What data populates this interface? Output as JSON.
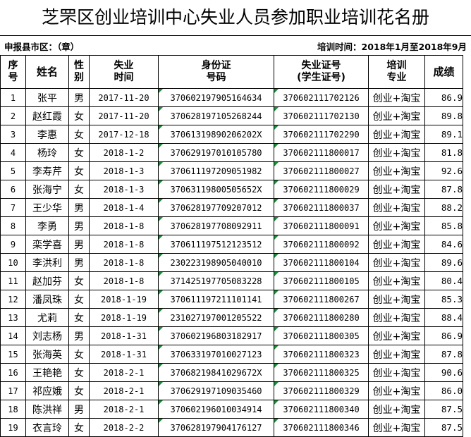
{
  "title": "芝罘区创业培训中心失业人员参加职业培训花名册",
  "subheader": {
    "left": "申报县市区：（章）",
    "right": "培训时间：2018年1月至2018年9月"
  },
  "columns": {
    "seq": [
      "序",
      "号"
    ],
    "name": "姓名",
    "gender": [
      "性",
      "别"
    ],
    "unemp_time": [
      "失业",
      "时间"
    ],
    "id_number": [
      "身份证",
      "号码"
    ],
    "unemp_cert": [
      "失业证号",
      "(学生证号)"
    ],
    "major": [
      "培训",
      "专业"
    ],
    "score": "成绩"
  },
  "rows": [
    {
      "seq": "1",
      "name": "张平",
      "gender": "男",
      "time": "2017-11-20",
      "id": "370602197905164634",
      "cert": "370602111702126",
      "major": "创业+淘宝",
      "score": "86.9"
    },
    {
      "seq": "2",
      "name": "赵红霞",
      "gender": "女",
      "time": "2017-11-20",
      "id": "370628197105268244",
      "cert": "370602111702130",
      "major": "创业+淘宝",
      "score": "89.8"
    },
    {
      "seq": "3",
      "name": "李惠",
      "gender": "女",
      "time": "2017-12-18",
      "id": "37061319890206202X",
      "cert": "370602111702290",
      "major": "创业+淘宝",
      "score": "89.1"
    },
    {
      "seq": "4",
      "name": "杨玲",
      "gender": "女",
      "time": "2018-1-2",
      "id": "370629197010105780",
      "cert": "370602111800017",
      "major": "创业+淘宝",
      "score": "81.8"
    },
    {
      "seq": "5",
      "name": "李寿芹",
      "gender": "女",
      "time": "2018-1-3",
      "id": "370611197209051982",
      "cert": "370602111800027",
      "major": "创业+淘宝",
      "score": "92.6"
    },
    {
      "seq": "6",
      "name": "张海宁",
      "gender": "女",
      "time": "2018-1-3",
      "id": "37063119800505652X",
      "cert": "370602111800029",
      "major": "创业+淘宝",
      "score": "87.8"
    },
    {
      "seq": "7",
      "name": "王少华",
      "gender": "男",
      "time": "2018-1-4",
      "id": "370628197709207012",
      "cert": "370602111800037",
      "major": "创业+淘宝",
      "score": "88.2"
    },
    {
      "seq": "8",
      "name": "李勇",
      "gender": "男",
      "time": "2018-1-8",
      "id": "370628197708092911",
      "cert": "370602111800091",
      "major": "创业+淘宝",
      "score": "85.8"
    },
    {
      "seq": "9",
      "name": "栾学喜",
      "gender": "男",
      "time": "2018-1-8",
      "id": "370611197512123512",
      "cert": "370602111800092",
      "major": "创业+淘宝",
      "score": "84.6"
    },
    {
      "seq": "10",
      "name": "李洪利",
      "gender": "男",
      "time": "2018-1-8",
      "id": "230223198905040010",
      "cert": "370602111800104",
      "major": "创业+淘宝",
      "score": "89.6"
    },
    {
      "seq": "11",
      "name": "赵加芬",
      "gender": "女",
      "time": "2018-1-8",
      "id": "371425197705083228",
      "cert": "370602111800105",
      "major": "创业+淘宝",
      "score": "80.4"
    },
    {
      "seq": "12",
      "name": "潘凤珠",
      "gender": "女",
      "time": "2018-1-19",
      "id": "370611197211101141",
      "cert": "370602111800267",
      "major": "创业+淘宝",
      "score": "85.3"
    },
    {
      "seq": "13",
      "name": "尤莉",
      "gender": "女",
      "time": "2018-1-19",
      "id": "231027197001205522",
      "cert": "370602111800280",
      "major": "创业+淘宝",
      "score": "88.4"
    },
    {
      "seq": "14",
      "name": "刘志杨",
      "gender": "男",
      "time": "2018-1-31",
      "id": "370602196803182917",
      "cert": "370602111800305",
      "major": "创业+淘宝",
      "score": "86.9"
    },
    {
      "seq": "15",
      "name": "张海英",
      "gender": "女",
      "time": "2018-1-31",
      "id": "370633197010027123",
      "cert": "370602111800323",
      "major": "创业+淘宝",
      "score": "87.8"
    },
    {
      "seq": "16",
      "name": "王艳艳",
      "gender": "女",
      "time": "2018-2-1",
      "id": "37068219841029672X",
      "cert": "370602111800325",
      "major": "创业+淘宝",
      "score": "90.6"
    },
    {
      "seq": "17",
      "name": "祁应娥",
      "gender": "女",
      "time": "2018-2-1",
      "id": "370629197109035460",
      "cert": "370602111800329",
      "major": "创业+淘宝",
      "score": "86.0"
    },
    {
      "seq": "18",
      "name": "陈洪祥",
      "gender": "男",
      "time": "2018-2-1",
      "id": "370602196010034914",
      "cert": "370602111800340",
      "major": "创业+淘宝",
      "score": "87.5"
    },
    {
      "seq": "19",
      "name": "衣言玲",
      "gender": "女",
      "time": "2018-2-2",
      "id": "370628197904176127",
      "cert": "370602111800346",
      "major": "创业+淘宝",
      "score": "87.5"
    }
  ],
  "colors": {
    "text": "#000000",
    "grid": "#000000",
    "marker": "#1a8a3a",
    "background": "#ffffff"
  }
}
